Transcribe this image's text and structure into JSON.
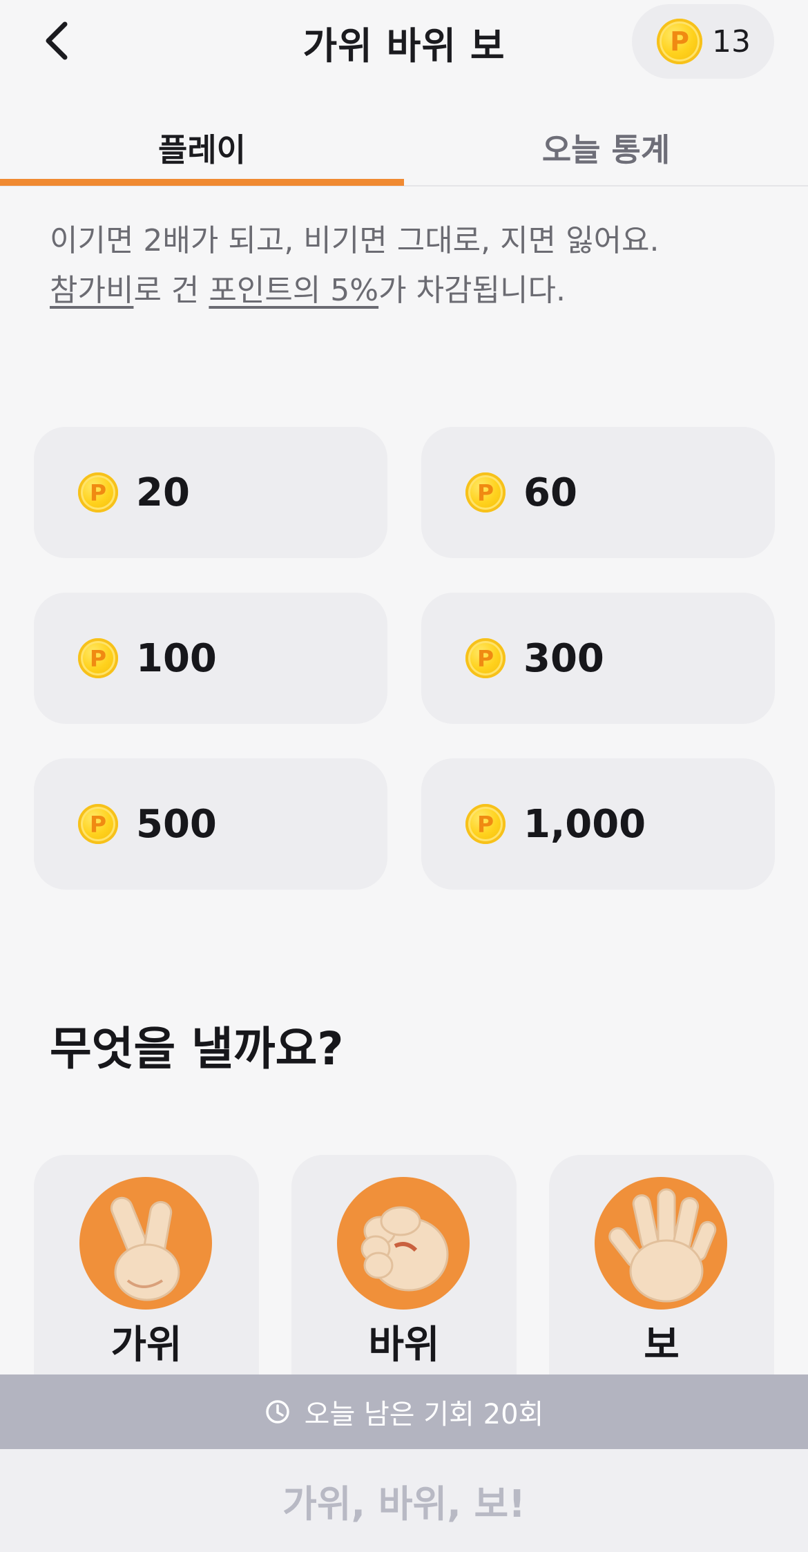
{
  "header": {
    "back_icon": "chevron-left-icon",
    "title": "가위 바위 보",
    "points": "13",
    "coin_symbol": "P"
  },
  "tabs": [
    {
      "label": "플레이",
      "active": true
    },
    {
      "label": "오늘 통계",
      "active": false
    }
  ],
  "description": {
    "line1": "이기면 2배가 되고, 비기면 그대로, 지면 잃어요.",
    "fee_link": "참가비",
    "text_mid": "로 건 ",
    "percent_link": "포인트의 5%",
    "text_end": "가 차감됩니다."
  },
  "bets": [
    {
      "amount": "20"
    },
    {
      "amount": "60"
    },
    {
      "amount": "100"
    },
    {
      "amount": "300"
    },
    {
      "amount": "500"
    },
    {
      "amount": "1,000"
    }
  ],
  "question": "무엇을 낼까요?",
  "choices": [
    {
      "label": "가위",
      "icon": "scissors-hand-icon"
    },
    {
      "label": "바위",
      "icon": "rock-fist-icon"
    },
    {
      "label": "보",
      "icon": "paper-hand-icon"
    }
  ],
  "remaining": {
    "icon": "clock-icon",
    "text": "오늘 남은 기회 20회"
  },
  "play_button": "가위, 바위, 보!",
  "colors": {
    "accent": "#f08a32",
    "card_bg": "#ededf0",
    "banner_bg": "#b3b4c0",
    "disabled_text": "#b8b9c4"
  }
}
